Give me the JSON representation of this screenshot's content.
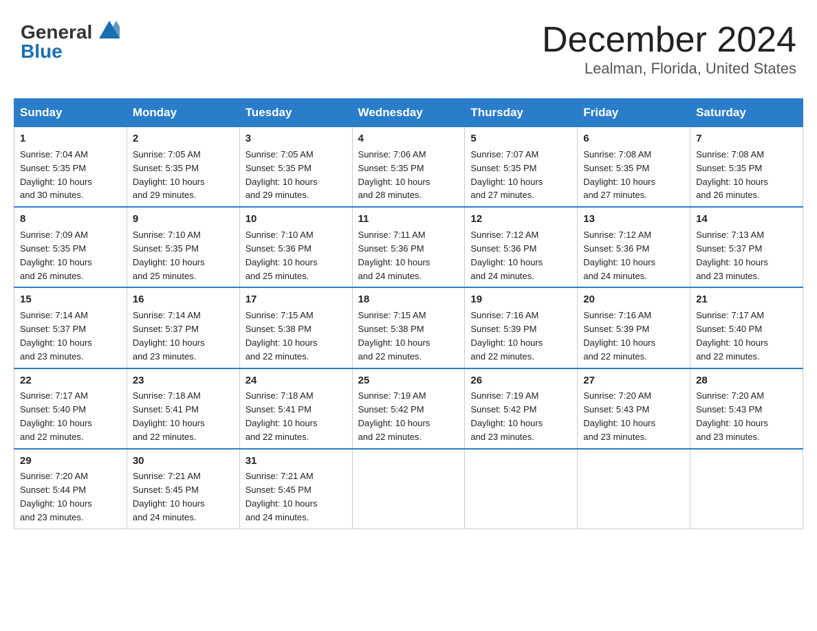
{
  "header": {
    "logo_general": "General",
    "logo_blue": "Blue",
    "title": "December 2024",
    "subtitle": "Lealman, Florida, United States"
  },
  "days_of_week": [
    "Sunday",
    "Monday",
    "Tuesday",
    "Wednesday",
    "Thursday",
    "Friday",
    "Saturday"
  ],
  "weeks": [
    [
      {
        "day": "1",
        "sunrise": "7:04 AM",
        "sunset": "5:35 PM",
        "daylight": "10 hours and 30 minutes."
      },
      {
        "day": "2",
        "sunrise": "7:05 AM",
        "sunset": "5:35 PM",
        "daylight": "10 hours and 29 minutes."
      },
      {
        "day": "3",
        "sunrise": "7:05 AM",
        "sunset": "5:35 PM",
        "daylight": "10 hours and 29 minutes."
      },
      {
        "day": "4",
        "sunrise": "7:06 AM",
        "sunset": "5:35 PM",
        "daylight": "10 hours and 28 minutes."
      },
      {
        "day": "5",
        "sunrise": "7:07 AM",
        "sunset": "5:35 PM",
        "daylight": "10 hours and 27 minutes."
      },
      {
        "day": "6",
        "sunrise": "7:08 AM",
        "sunset": "5:35 PM",
        "daylight": "10 hours and 27 minutes."
      },
      {
        "day": "7",
        "sunrise": "7:08 AM",
        "sunset": "5:35 PM",
        "daylight": "10 hours and 26 minutes."
      }
    ],
    [
      {
        "day": "8",
        "sunrise": "7:09 AM",
        "sunset": "5:35 PM",
        "daylight": "10 hours and 26 minutes."
      },
      {
        "day": "9",
        "sunrise": "7:10 AM",
        "sunset": "5:35 PM",
        "daylight": "10 hours and 25 minutes."
      },
      {
        "day": "10",
        "sunrise": "7:10 AM",
        "sunset": "5:36 PM",
        "daylight": "10 hours and 25 minutes."
      },
      {
        "day": "11",
        "sunrise": "7:11 AM",
        "sunset": "5:36 PM",
        "daylight": "10 hours and 24 minutes."
      },
      {
        "day": "12",
        "sunrise": "7:12 AM",
        "sunset": "5:36 PM",
        "daylight": "10 hours and 24 minutes."
      },
      {
        "day": "13",
        "sunrise": "7:12 AM",
        "sunset": "5:36 PM",
        "daylight": "10 hours and 24 minutes."
      },
      {
        "day": "14",
        "sunrise": "7:13 AM",
        "sunset": "5:37 PM",
        "daylight": "10 hours and 23 minutes."
      }
    ],
    [
      {
        "day": "15",
        "sunrise": "7:14 AM",
        "sunset": "5:37 PM",
        "daylight": "10 hours and 23 minutes."
      },
      {
        "day": "16",
        "sunrise": "7:14 AM",
        "sunset": "5:37 PM",
        "daylight": "10 hours and 23 minutes."
      },
      {
        "day": "17",
        "sunrise": "7:15 AM",
        "sunset": "5:38 PM",
        "daylight": "10 hours and 22 minutes."
      },
      {
        "day": "18",
        "sunrise": "7:15 AM",
        "sunset": "5:38 PM",
        "daylight": "10 hours and 22 minutes."
      },
      {
        "day": "19",
        "sunrise": "7:16 AM",
        "sunset": "5:39 PM",
        "daylight": "10 hours and 22 minutes."
      },
      {
        "day": "20",
        "sunrise": "7:16 AM",
        "sunset": "5:39 PM",
        "daylight": "10 hours and 22 minutes."
      },
      {
        "day": "21",
        "sunrise": "7:17 AM",
        "sunset": "5:40 PM",
        "daylight": "10 hours and 22 minutes."
      }
    ],
    [
      {
        "day": "22",
        "sunrise": "7:17 AM",
        "sunset": "5:40 PM",
        "daylight": "10 hours and 22 minutes."
      },
      {
        "day": "23",
        "sunrise": "7:18 AM",
        "sunset": "5:41 PM",
        "daylight": "10 hours and 22 minutes."
      },
      {
        "day": "24",
        "sunrise": "7:18 AM",
        "sunset": "5:41 PM",
        "daylight": "10 hours and 22 minutes."
      },
      {
        "day": "25",
        "sunrise": "7:19 AM",
        "sunset": "5:42 PM",
        "daylight": "10 hours and 22 minutes."
      },
      {
        "day": "26",
        "sunrise": "7:19 AM",
        "sunset": "5:42 PM",
        "daylight": "10 hours and 23 minutes."
      },
      {
        "day": "27",
        "sunrise": "7:20 AM",
        "sunset": "5:43 PM",
        "daylight": "10 hours and 23 minutes."
      },
      {
        "day": "28",
        "sunrise": "7:20 AM",
        "sunset": "5:43 PM",
        "daylight": "10 hours and 23 minutes."
      }
    ],
    [
      {
        "day": "29",
        "sunrise": "7:20 AM",
        "sunset": "5:44 PM",
        "daylight": "10 hours and 23 minutes."
      },
      {
        "day": "30",
        "sunrise": "7:21 AM",
        "sunset": "5:45 PM",
        "daylight": "10 hours and 24 minutes."
      },
      {
        "day": "31",
        "sunrise": "7:21 AM",
        "sunset": "5:45 PM",
        "daylight": "10 hours and 24 minutes."
      },
      null,
      null,
      null,
      null
    ]
  ],
  "labels": {
    "sunrise": "Sunrise:",
    "sunset": "Sunset:",
    "daylight": "Daylight:"
  }
}
